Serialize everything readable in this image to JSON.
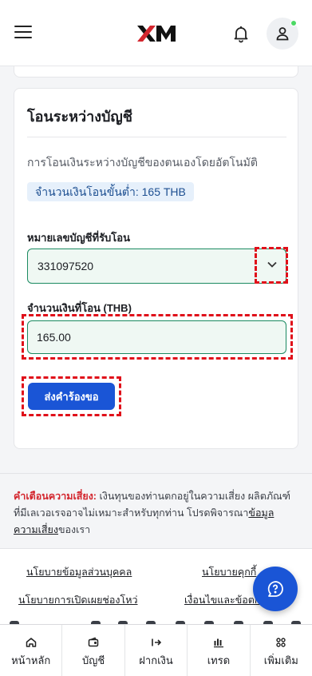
{
  "header": {
    "logo_text": "XM"
  },
  "transfer_card": {
    "title": "โอนระหว่างบัญชี",
    "description": "การโอนเงินระหว่างบัญชีของตนเองโดยอัตโนมัติ",
    "min_amount_label": "จำนวนเงินโอนขั้นต่ำ: 165 THB",
    "account_field_label": "หมายเลขบัญชีที่รับโอน",
    "account_selected": "331097520",
    "amount_field_label": "จำนวนเงินที่โอน (THB)",
    "amount_value": "165.00",
    "submit_label": "ส่งคำร้องขอ"
  },
  "risk": {
    "label": "คำเตือนความเสี่ยง:",
    "text": " เงินทุนของท่านตกอยู่ในความเสี่ยง ผลิตภัณฑ์ที่มีเลเวอเรจอาจไม่เหมาะสำหรับทุกท่าน โปรดพิจารณา",
    "link": "ข้อมูลความเสี่ยง",
    "suffix": "ของเรา"
  },
  "footer": {
    "links": [
      "นโยบายข้อมูลส่วนบุคคล",
      "นโยบายคุกกี้",
      "นโยบายการเปิดเผยช่องโหว่",
      "เงื่อนไขและข้อตกลง"
    ]
  },
  "bottom_nav": [
    {
      "label": "หน้าหลัก",
      "icon": "home-icon"
    },
    {
      "label": "บัญชี",
      "icon": "wallet-icon"
    },
    {
      "label": "ฝากเงิน",
      "icon": "deposit-icon"
    },
    {
      "label": "เทรด",
      "icon": "trade-icon"
    },
    {
      "label": "เพิ่มเติม",
      "icon": "more-icon"
    }
  ],
  "colors": {
    "accent": "#1a55d6",
    "field_border": "#1b8a61",
    "field_bg": "#eff8f3",
    "warning": "#d3262e",
    "highlight": "#e0101a"
  }
}
